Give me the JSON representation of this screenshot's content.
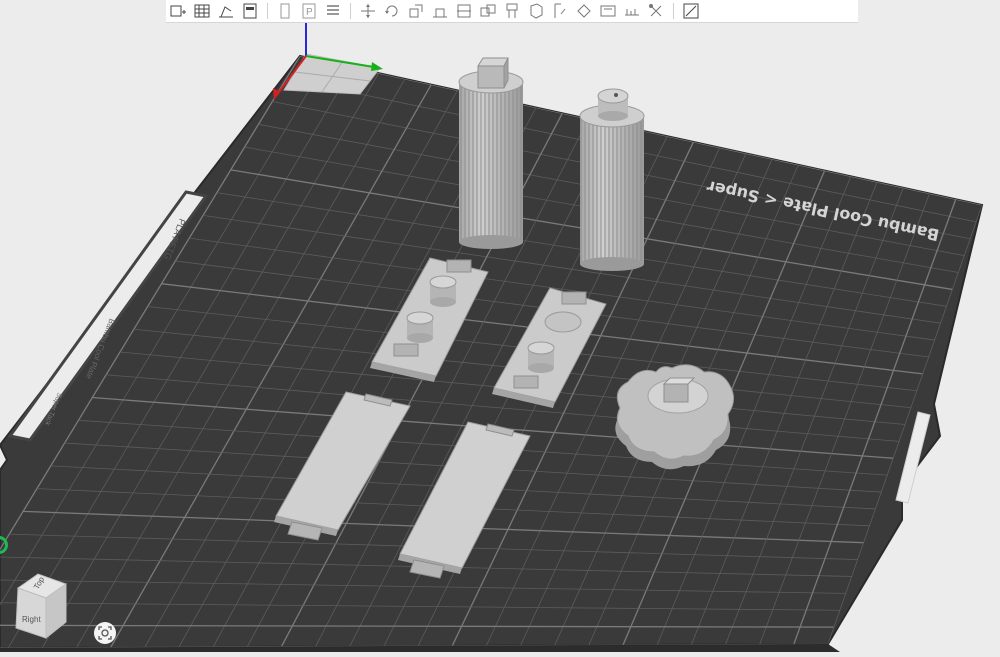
{
  "toolbar": {
    "groups": [
      [
        "add-plate-icon",
        "arrange-icon",
        "orient-icon",
        "layout-icon"
      ],
      [
        "object-list-icon",
        "plate-p-icon",
        "layers-icon"
      ],
      [
        "move-icon",
        "rotate-icon",
        "scale-icon",
        "lay-on-face-icon",
        "cut-icon",
        "mesh-boolean-icon",
        "support-paint-icon",
        "seam-paint-icon",
        "fuzzy-skin-icon",
        "color-paint-icon",
        "text-icon",
        "measure-icon",
        "assembly-icon"
      ],
      [
        "variable-layer-icon"
      ]
    ]
  },
  "plate": {
    "label": "Bambu Cool Plate",
    "sub_label": "Super...",
    "top_label": "Bambu Cool Plate < Super",
    "side_label": "PLA PETG",
    "side_subtext": "Bambu Cool Plate",
    "side_small": "Super Tack"
  },
  "view_cube": {
    "top": "Top",
    "right": "Right"
  },
  "colors": {
    "background": "#ececec",
    "plate": "#3a3a3a",
    "grid": "#5c5c5c",
    "model": "#bdbdbd",
    "axis_x": "#d62020",
    "axis_y": "#19b019",
    "axis_z": "#2828d8",
    "accent": "#1db954"
  }
}
